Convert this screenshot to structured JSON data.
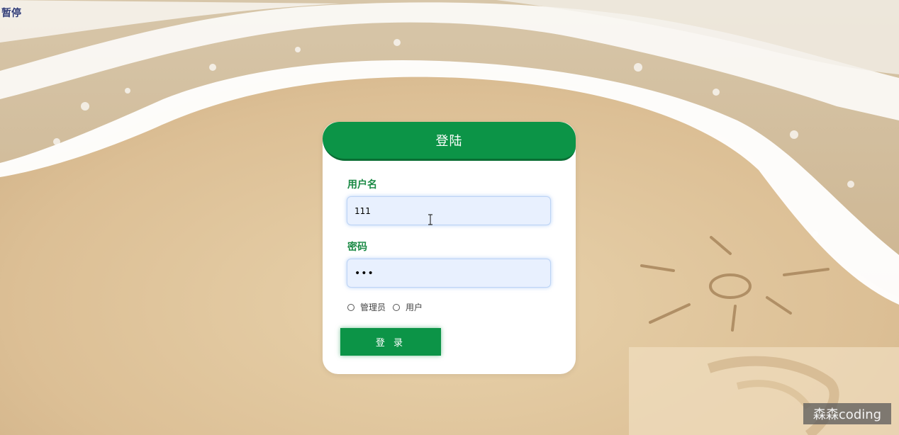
{
  "overlay": {
    "pause_label": "暂停",
    "watermark": "森森coding"
  },
  "login_card": {
    "title": "登陆",
    "username": {
      "label": "用户名",
      "value": "111"
    },
    "password": {
      "label": "密码",
      "value": "•••"
    },
    "roles": [
      "管理员",
      "用户"
    ],
    "submit_label": "登 录"
  },
  "colors": {
    "primary_green": "#0c9447",
    "label_green": "#1b8a45",
    "input_bg": "#e8f0fe",
    "sand": "#dcc198",
    "foam": "#ffffff"
  },
  "icons": {
    "cursor": "text-cursor-icon"
  }
}
